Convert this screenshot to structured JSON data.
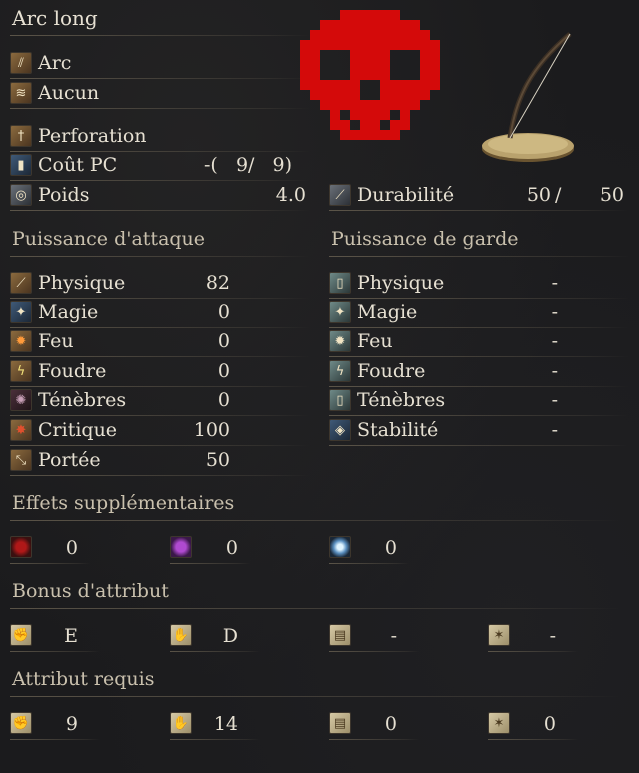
{
  "weapon": {
    "name": "Arc long",
    "category": "Arc",
    "skill": "Aucun",
    "damage_type": "Perforation",
    "fp_cost_label": "Coût PC",
    "fp_cost_value": "-(   9/   9)",
    "weight_label": "Poids",
    "weight_value": "4.0",
    "durability_label": "Durabilité",
    "durability_current": "50",
    "durability_sep": "/",
    "durability_max": "50"
  },
  "attack": {
    "title": "Puissance d'attaque",
    "rows": [
      {
        "label": "Physique",
        "value": "82",
        "icon": "physical-attack-icon"
      },
      {
        "label": "Magie",
        "value": "0",
        "icon": "magic-icon"
      },
      {
        "label": "Feu",
        "value": "0",
        "icon": "fire-icon"
      },
      {
        "label": "Foudre",
        "value": "0",
        "icon": "lightning-icon"
      },
      {
        "label": "Ténèbres",
        "value": "0",
        "icon": "dark-icon"
      },
      {
        "label": "Critique",
        "value": "100",
        "icon": "critical-icon"
      },
      {
        "label": "Portée",
        "value": "50",
        "icon": "range-icon"
      }
    ]
  },
  "guard": {
    "title": "Puissance de garde",
    "rows": [
      {
        "label": "Physique",
        "value": "-",
        "icon": "physical-guard-icon"
      },
      {
        "label": "Magie",
        "value": "-",
        "icon": "magic-guard-icon"
      },
      {
        "label": "Feu",
        "value": "-",
        "icon": "fire-guard-icon"
      },
      {
        "label": "Foudre",
        "value": "-",
        "icon": "lightning-guard-icon"
      },
      {
        "label": "Ténèbres",
        "value": "-",
        "icon": "dark-guard-icon"
      },
      {
        "label": "Stabilité",
        "value": "-",
        "icon": "stability-icon"
      }
    ]
  },
  "effects": {
    "title": "Effets supplémentaires",
    "values": [
      "0",
      "0",
      "0"
    ],
    "icons": [
      "bleed-icon",
      "poison-icon",
      "frost-icon"
    ]
  },
  "bonus": {
    "title": "Bonus d'attribut",
    "values": [
      "E",
      "D",
      "-",
      "-"
    ],
    "icons": [
      "strength-icon",
      "dexterity-icon",
      "intelligence-icon",
      "faith-icon"
    ]
  },
  "requirements": {
    "title": "Attribut requis",
    "values": [
      "9",
      "14",
      "0",
      "0"
    ],
    "icons": [
      "strength-icon",
      "dexterity-icon",
      "intelligence-icon",
      "faith-icon"
    ]
  },
  "colors": {
    "skull": "#d40a0a",
    "text": "#e6e0d2",
    "section": "#c9c0ad"
  }
}
